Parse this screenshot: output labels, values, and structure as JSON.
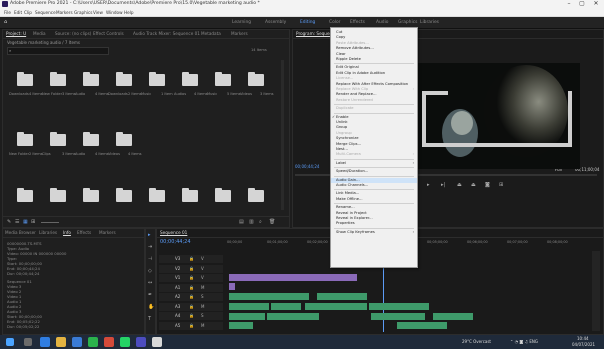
{
  "window": {
    "title": "Adobe Premiere Pro 2021 - C:\\Users\\USER\\Documents\\Adobe\\Premiere Pro\\15.0\\Vegetable marketing audio *",
    "controls": [
      "–",
      "▢",
      "✕"
    ]
  },
  "menubar": [
    "File",
    "Edit",
    "Clip",
    "Sequence",
    "Markers",
    "Graphics",
    "View",
    "Window",
    "Help"
  ],
  "workspaces": [
    "Learning",
    "Assembly",
    "Editing",
    "Color",
    "Effects",
    "Audio",
    "Graphics",
    "Libraries"
  ],
  "active_workspace": "Editing",
  "project_panel": {
    "tabs": [
      "Project: U",
      "Media",
      "Source: (no clips)",
      "Effect Controls",
      "Audio Track Mixer: Sequence 01",
      "Metadata",
      "Markers"
    ],
    "path": "Vegetable marketing audio / 7 Items",
    "search_placeholder": "",
    "count": "14 Items",
    "folders": [
      {
        "name": "Downloads",
        "info": "4 Items"
      },
      {
        "name": "New Folder",
        "info": "3 Items"
      },
      {
        "name": "Audio",
        "info": "4 Items"
      },
      {
        "name": "Downloads",
        "info": "2 Items"
      },
      {
        "name": "Music",
        "info": "1 Item"
      },
      {
        "name": "Audios",
        "info": "4 Items"
      },
      {
        "name": "Music",
        "info": "5 Items"
      },
      {
        "name": "Videos",
        "info": "3 Items"
      },
      {
        "name": "New Folder",
        "info": "2 Items"
      },
      {
        "name": "Clips",
        "info": "3 Items"
      },
      {
        "name": "Audio",
        "info": "4 Items"
      },
      {
        "name": "Videos",
        "info": "4 Items"
      }
    ]
  },
  "program_monitor": {
    "title": "Program: Sequence 01",
    "timecode": "00;00;44;24",
    "end_timecode": "00;11;00;04",
    "fit": "Full"
  },
  "context_menu": {
    "items": [
      {
        "label": "Cut",
        "enabled": true
      },
      {
        "label": "Copy",
        "enabled": true
      },
      {
        "label": "Paste Attributes...",
        "enabled": false
      },
      {
        "label": "Remove Attributes...",
        "enabled": true
      },
      {
        "label": "Clear",
        "enabled": true
      },
      {
        "label": "Ripple Delete",
        "enabled": true
      },
      {
        "sep": true
      },
      {
        "label": "Edit Original",
        "enabled": true
      },
      {
        "label": "Edit Clip in Adobe Audition",
        "enabled": true
      },
      {
        "label": "License...",
        "enabled": false
      },
      {
        "label": "Replace With After Effects Composition",
        "enabled": true
      },
      {
        "label": "Replace With Clip",
        "enabled": false,
        "submenu": true
      },
      {
        "label": "Render and Replace...",
        "enabled": true
      },
      {
        "label": "Restore Unrendered",
        "enabled": false
      },
      {
        "sep": true
      },
      {
        "label": "Duplicate",
        "enabled": false
      },
      {
        "sep": true
      },
      {
        "label": "Enable",
        "enabled": true,
        "checked": true
      },
      {
        "label": "Unlink",
        "enabled": true
      },
      {
        "label": "Group",
        "enabled": true
      },
      {
        "label": "Ungroup",
        "enabled": false
      },
      {
        "label": "Synchronize",
        "enabled": true
      },
      {
        "label": "Merge Clips...",
        "enabled": true
      },
      {
        "label": "Nest...",
        "enabled": true
      },
      {
        "label": "Multi-Camera",
        "enabled": false,
        "submenu": true
      },
      {
        "sep": true
      },
      {
        "label": "Label",
        "enabled": true,
        "submenu": true
      },
      {
        "sep": true
      },
      {
        "label": "Speed/Duration...",
        "enabled": true
      },
      {
        "sep": true
      },
      {
        "label": "Audio Gain...",
        "enabled": true,
        "highlighted": true
      },
      {
        "label": "Audio Channels...",
        "enabled": true
      },
      {
        "sep": true
      },
      {
        "label": "Link Media...",
        "enabled": true
      },
      {
        "label": "Make Offline...",
        "enabled": true
      },
      {
        "sep": true
      },
      {
        "label": "Rename...",
        "enabled": true
      },
      {
        "label": "Reveal in Project",
        "enabled": true
      },
      {
        "label": "Reveal in Explorer...",
        "enabled": true
      },
      {
        "label": "Properties",
        "enabled": true
      },
      {
        "sep": true
      },
      {
        "label": "Show Clip Keyframes",
        "enabled": true,
        "submenu": true
      }
    ]
  },
  "effects_panel": {
    "tabs": [
      "Media Browser",
      "Libraries",
      "Info",
      "Effects",
      "Markers"
    ],
    "lines": [
      "00000000.TS.MTS",
      "Type: Audio",
      "Video: 00000 IN 000000 00000",
      "Type:",
      "Start: 00;00;00;00",
      "End: 00;00;44;24",
      "Dur: 00;00;44;24"
    ],
    "lines2": [
      "Sequence 01",
      "Video 3",
      "Video 2",
      "Video 1",
      "Audio 1",
      "Audio 2",
      "Audio 3",
      "Start: 00;00;00;00",
      "End: 00;05;02;22",
      "Dur: 00;05;02;22"
    ]
  },
  "timeline": {
    "tab": "Sequence 01",
    "timecode": "00;00;44;24",
    "ruler": [
      "00;00;00",
      "00;01;00;00",
      "00;02;00;00",
      "00;03;00;00",
      "00;04;00;00",
      "00;05;00;00",
      "00;06;00;00",
      "00;07;00;00",
      "00;08;00;00"
    ],
    "tracks": [
      "V3",
      "V2",
      "V1",
      "A1",
      "A2",
      "A3",
      "A4",
      "A5"
    ],
    "track_labels": [
      "V",
      "V",
      "V",
      "M",
      "S",
      "M",
      "S",
      "M"
    ]
  },
  "taskbar": {
    "weather": "29°C Overcast",
    "time": "10:44",
    "date": "04/07/2021"
  },
  "colors": {
    "accent": "#5b9bf5",
    "video_clip": "#8a6ab8",
    "audio_clip": "#3e9a6a",
    "menu_highlight": "#cfe3f8"
  }
}
